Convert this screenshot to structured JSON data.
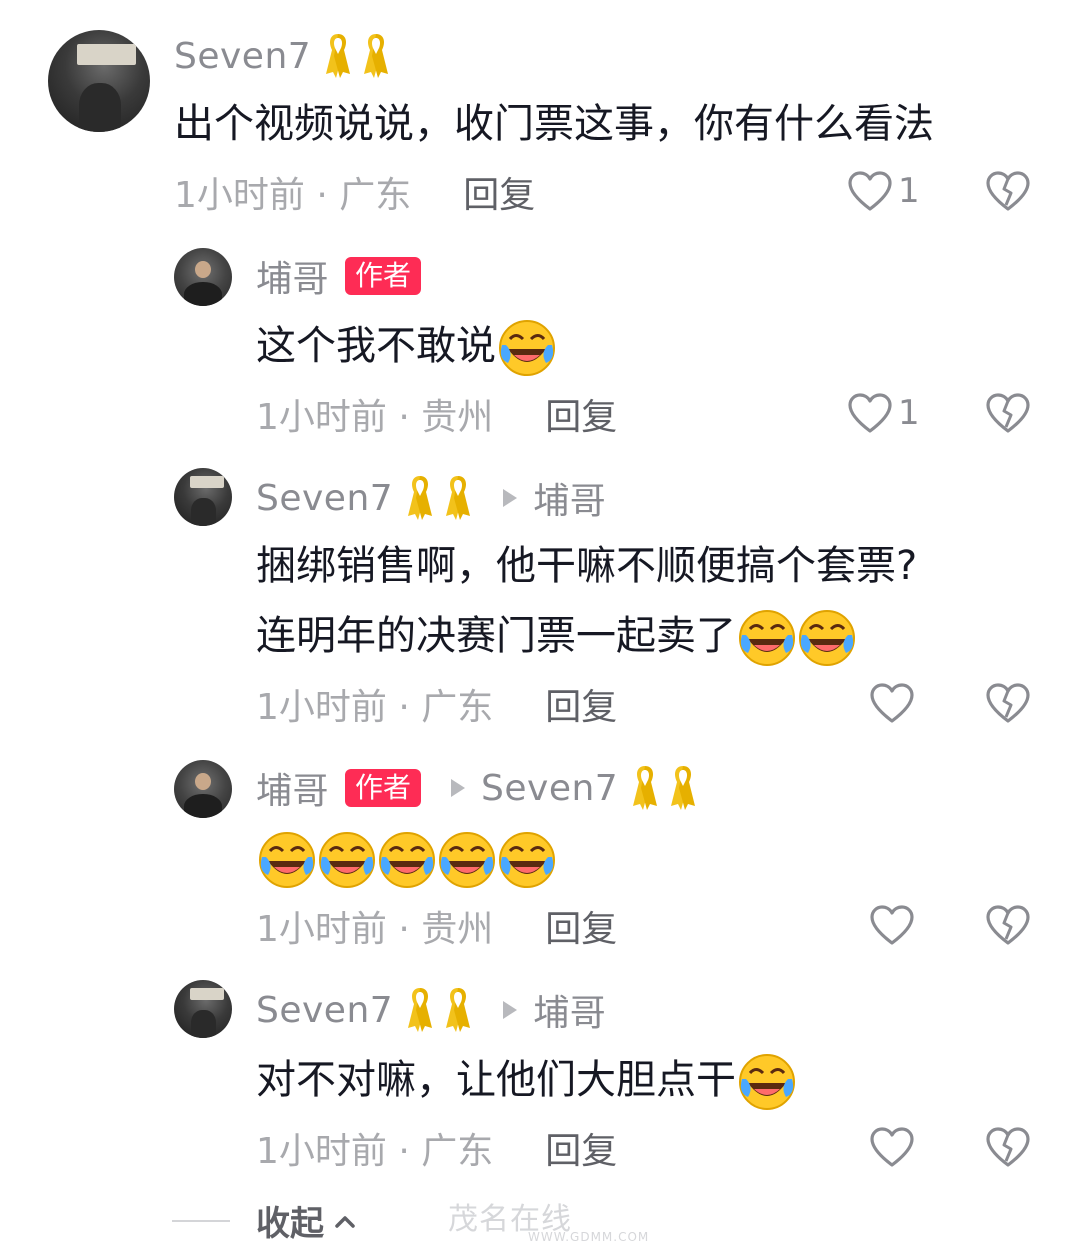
{
  "comments": [
    {
      "user": "Seven7",
      "is_author": false,
      "reply_to": "",
      "text": "出个视频说说，收门票这事，你有什么看法",
      "emoji_count": 0,
      "meta": "1小时前 · 广东",
      "reply_label": "回复",
      "likes": "1"
    },
    {
      "user": "埔哥",
      "is_author": true,
      "author_label": "作者",
      "reply_to": "",
      "text": "这个我不敢说",
      "emoji_count": 1,
      "meta": "1小时前 · 贵州",
      "reply_label": "回复",
      "likes": "1"
    },
    {
      "user": "Seven7",
      "is_author": false,
      "reply_to": "埔哥",
      "text_line1": "捆绑销售啊，他干嘛不顺便搞个套票?",
      "text": "连明年的决赛门票一起卖了",
      "emoji_count": 2,
      "meta": "1小时前 · 广东",
      "reply_label": "回复",
      "likes": ""
    },
    {
      "user": "埔哥",
      "is_author": true,
      "author_label": "作者",
      "reply_to": "Seven7",
      "text": "",
      "emoji_count": 5,
      "meta": "1小时前 · 贵州",
      "reply_label": "回复",
      "likes": ""
    },
    {
      "user": "Seven7",
      "is_author": false,
      "reply_to": "埔哥",
      "text": "对不对嘛，让他们大胆点干",
      "emoji_count": 1,
      "meta": "1小时前 · 广东",
      "reply_label": "回复",
      "likes": ""
    }
  ],
  "collapse_label": "收起",
  "watermark": "茂名在线",
  "watermark_url": "WWW.GDMM.COM",
  "icons": {
    "ribbon": "yellow-ribbon-icon",
    "emoji": "laughing-crying-emoji-icon",
    "like": "heart-outline-icon",
    "dislike": "broken-heart-icon"
  },
  "colors": {
    "author_badge": "#fe2c55",
    "ribbon": "#f5c518",
    "meta": "#a8a9ad"
  }
}
